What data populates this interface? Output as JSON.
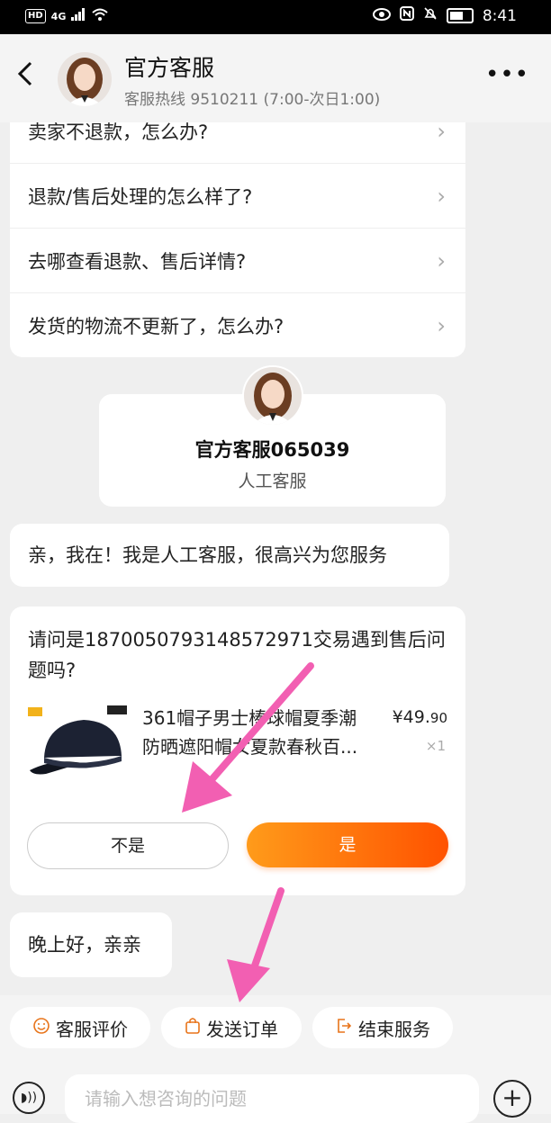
{
  "status_bar": {
    "hd": "HD",
    "network": "4G",
    "time": "8:41"
  },
  "header": {
    "title": "官方客服",
    "subtitle": "客服热线 9510211 (7:00-次日1:00)"
  },
  "faq": [
    {
      "label": "卖家不退款，怎么办?"
    },
    {
      "label": "退款/售后处理的怎么样了?"
    },
    {
      "label": "去哪查看退款、售后详情?"
    },
    {
      "label": "发货的物流不更新了，怎么办?"
    }
  ],
  "agent": {
    "name": "官方客服065039",
    "role": "人工客服"
  },
  "messages": {
    "greeting": "亲，我在！我是人工客服，很高兴为您服务",
    "evening": "晚上好，亲亲"
  },
  "order": {
    "question": "请问是1870050793148572971交易遇到售后问题吗?",
    "product_title": "361帽子男士棒球帽夏季潮防晒遮阳帽女夏款春秋百...",
    "price_main": "¥49.",
    "price_dec": "90",
    "quantity": "×1",
    "no_label": "不是",
    "yes_label": "是"
  },
  "actions": {
    "rate": "客服评价",
    "send_order": "发送订单",
    "end": "结束服务"
  },
  "input": {
    "placeholder": "请输入想咨询的问题"
  },
  "colors": {
    "accent": "#ff6a00",
    "arrow": "#f25fb2"
  }
}
